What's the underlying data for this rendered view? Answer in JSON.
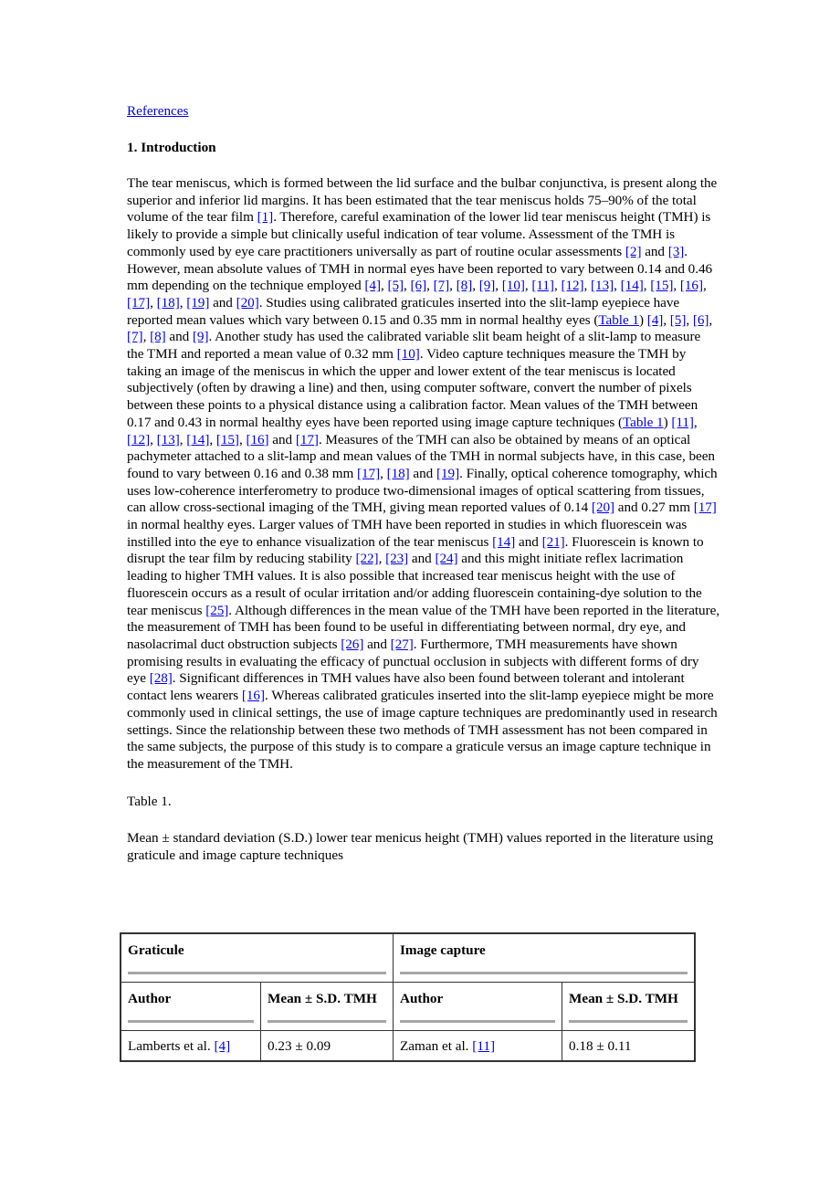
{
  "nav": {
    "references_link": "References"
  },
  "section": {
    "title": "1. Introduction"
  },
  "paragraph": [
    {
      "t": "The tear meniscus, which is formed between the lid surface and the bulbar conjunctiva, is present along the superior and inferior lid margins. It has been estimated that the tear meniscus holds 75–90% of the total volume of the tear film "
    },
    {
      "l": "[1]"
    },
    {
      "t": ". Therefore, careful examination of the lower lid tear meniscus height (TMH) is likely to provide a simple but clinically useful indication of tear volume. Assessment of the TMH is commonly used by eye care practitioners universally as part of routine ocular assessments "
    },
    {
      "l": "[2]"
    },
    {
      "t": " and "
    },
    {
      "l": "[3]"
    },
    {
      "t": ". However, mean absolute values of TMH in normal eyes have been reported to vary between 0.14 and 0.46 mm depending on the technique employed "
    },
    {
      "l": "[4]"
    },
    {
      "t": ", "
    },
    {
      "l": "[5]"
    },
    {
      "t": ", "
    },
    {
      "l": "[6]"
    },
    {
      "t": ", "
    },
    {
      "l": "[7]"
    },
    {
      "t": ", "
    },
    {
      "l": "[8]"
    },
    {
      "t": ", "
    },
    {
      "l": "[9]"
    },
    {
      "t": ", "
    },
    {
      "l": "[10]"
    },
    {
      "t": ", "
    },
    {
      "l": "[11]"
    },
    {
      "t": ", "
    },
    {
      "l": "[12]"
    },
    {
      "t": ", "
    },
    {
      "l": "[13]"
    },
    {
      "t": ", "
    },
    {
      "l": "[14]"
    },
    {
      "t": ", "
    },
    {
      "l": "[15]"
    },
    {
      "t": ", "
    },
    {
      "l": "[16]"
    },
    {
      "t": ", "
    },
    {
      "l": "[17]"
    },
    {
      "t": ", "
    },
    {
      "l": "[18]"
    },
    {
      "t": ", "
    },
    {
      "l": "[19]"
    },
    {
      "t": " and "
    },
    {
      "l": "[20]"
    },
    {
      "t": ". Studies using calibrated graticules inserted into the slit-lamp eyepiece have reported mean values which vary between 0.15 and 0.35 mm in normal healthy eyes ("
    },
    {
      "l": "Table 1"
    },
    {
      "t": ") "
    },
    {
      "l": "[4]"
    },
    {
      "t": ", "
    },
    {
      "l": "[5]"
    },
    {
      "t": ", "
    },
    {
      "l": "[6]"
    },
    {
      "t": ", "
    },
    {
      "l": "[7]"
    },
    {
      "t": ", "
    },
    {
      "l": "[8]"
    },
    {
      "t": " and "
    },
    {
      "l": "[9]"
    },
    {
      "t": ". Another study has used the calibrated variable slit beam height of a slit-lamp to measure the TMH and reported a mean value of 0.32 mm "
    },
    {
      "l": "[10]"
    },
    {
      "t": ". Video capture techniques measure the TMH by taking an image of the meniscus in which the upper and lower extent of the tear meniscus is located subjectively (often by drawing a line) and then, using computer software, convert the number of pixels between these points to a physical distance using a calibration factor. Mean values of the TMH between 0.17 and 0.43 in normal healthy eyes have been reported using image capture techniques ("
    },
    {
      "l": "Table 1"
    },
    {
      "t": ") "
    },
    {
      "l": "[11]"
    },
    {
      "t": ", "
    },
    {
      "l": "[12]"
    },
    {
      "t": ", "
    },
    {
      "l": "[13]"
    },
    {
      "t": ", "
    },
    {
      "l": "[14]"
    },
    {
      "t": ", "
    },
    {
      "l": "[15]"
    },
    {
      "t": ", "
    },
    {
      "l": "[16]"
    },
    {
      "t": " and "
    },
    {
      "l": "[17]"
    },
    {
      "t": ". Measures of the TMH can also be obtained by means of an optical pachymeter attached to a slit-lamp and mean values of the TMH in normal subjects have, in this case, been found to vary between 0.16 and 0.38 mm "
    },
    {
      "l": "[17]"
    },
    {
      "t": ", "
    },
    {
      "l": "[18]"
    },
    {
      "t": " and "
    },
    {
      "l": "[19]"
    },
    {
      "t": ". Finally, optical coherence tomography, which uses low-coherence interferometry to produce two-dimensional images of optical scattering from tissues, can allow cross-sectional imaging of the TMH, giving mean reported values of 0.14 "
    },
    {
      "l": "[20]"
    },
    {
      "t": " and 0.27 mm "
    },
    {
      "l": "[17]"
    },
    {
      "t": " in normal healthy eyes. Larger values of TMH have been reported in studies in which fluorescein was instilled into the eye to enhance visualization of the tear meniscus "
    },
    {
      "l": "[14]"
    },
    {
      "t": " and "
    },
    {
      "l": "[21]"
    },
    {
      "t": ". Fluorescein is known to disrupt the tear film by reducing stability "
    },
    {
      "l": "[22]"
    },
    {
      "t": ", "
    },
    {
      "l": "[23]"
    },
    {
      "t": " and "
    },
    {
      "l": "[24]"
    },
    {
      "t": " and this might initiate reflex lacrimation leading to higher TMH values. It is also possible that increased tear meniscus height with the use of fluorescein occurs as a result of ocular irritation and/or adding fluorescein containing-dye solution to the tear meniscus "
    },
    {
      "l": "[25]"
    },
    {
      "t": ". Although differences in the mean value of the TMH have been reported in the literature, the measurement of TMH has been found to be useful in differentiating between normal, dry eye, and nasolacrimal duct obstruction subjects "
    },
    {
      "l": "[26]"
    },
    {
      "t": " and "
    },
    {
      "l": "[27]"
    },
    {
      "t": ". Furthermore, TMH measurements have shown promising results in evaluating the efficacy of punctual occlusion in subjects with different forms of dry eye "
    },
    {
      "l": "[28]"
    },
    {
      "t": ". Significant differences in TMH values have also been found between tolerant and intolerant contact lens wearers "
    },
    {
      "l": "[16]"
    },
    {
      "t": ". Whereas calibrated graticules inserted into the slit-lamp eyepiece might be more commonly used in clinical settings, the use of image capture techniques are predominantly used in research settings. Since the relationship between these two methods of TMH assessment has not been compared in the same subjects, the purpose of this study is to compare a graticule versus an image capture technique in the measurement of the TMH."
    }
  ],
  "table": {
    "label": "Table 1.",
    "caption": "Mean ± standard deviation (S.D.) lower tear menicus height (TMH) values reported in the literature using graticule and image capture techniques",
    "group_headers": [
      "Graticule",
      "Image capture"
    ],
    "column_headers": [
      "Author",
      "Mean ± S.D. TMH",
      "Author",
      "Mean ± S.D. TMH"
    ],
    "rows": [
      {
        "graticule_author": "Lamberts et al. ",
        "graticule_ref": "[4]",
        "graticule_value": "0.23 ± 0.09",
        "image_author": "Zaman et al. ",
        "image_ref": "[11]",
        "image_value": "0.18 ± 0.11"
      }
    ]
  },
  "colors": {
    "link": "#0000ee",
    "text": "#000000",
    "header_rule": "#a6a6a6",
    "border": "#333333"
  }
}
